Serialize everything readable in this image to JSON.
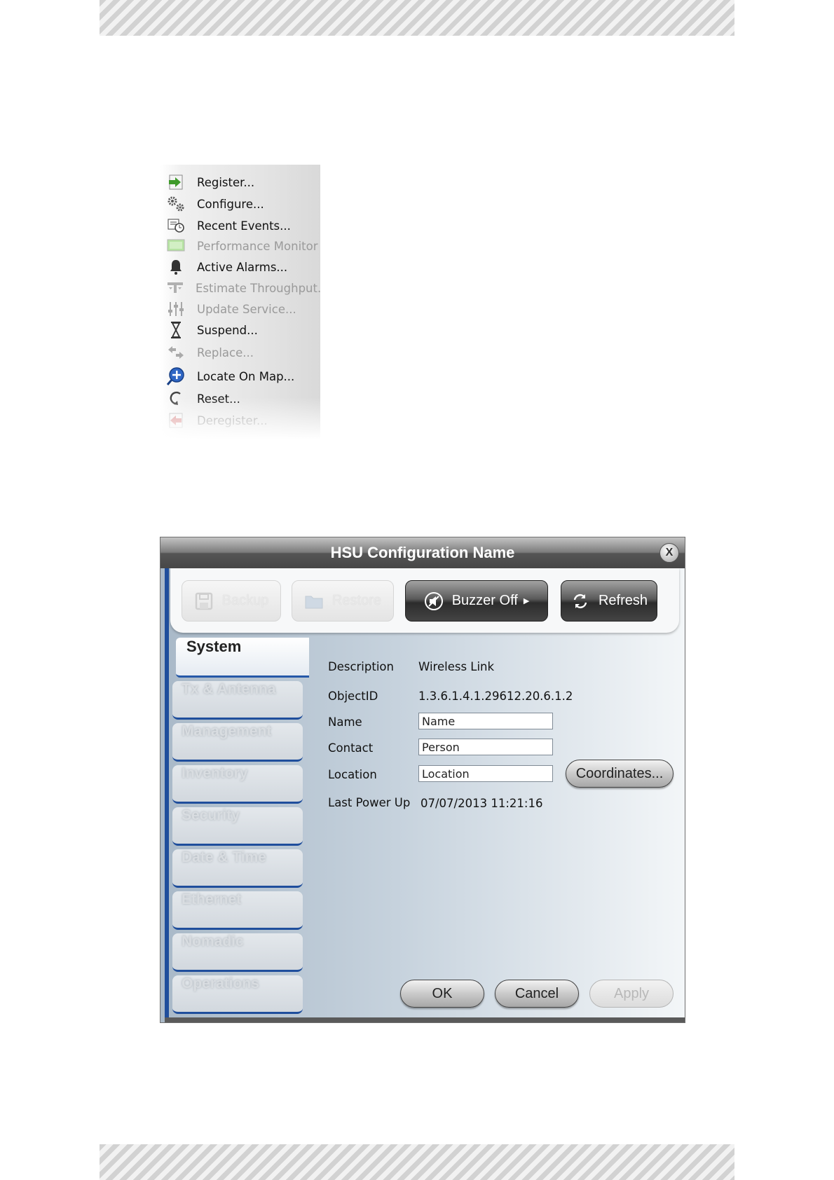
{
  "context_menu": {
    "items": [
      {
        "label": "Register...",
        "enabled": true,
        "icon": "register-icon"
      },
      {
        "label": "Configure...",
        "enabled": true,
        "icon": "gears-icon"
      },
      {
        "label": "Recent Events...",
        "enabled": true,
        "icon": "events-icon"
      },
      {
        "label": "Performance Monitor",
        "enabled": false,
        "icon": "monitor-icon"
      },
      {
        "label": "Active Alarms...",
        "enabled": true,
        "icon": "bell-icon"
      },
      {
        "label": "Estimate Throughput...",
        "enabled": false,
        "icon": "throughput-icon"
      },
      {
        "label": "Update Service...",
        "enabled": false,
        "icon": "sliders-icon"
      },
      {
        "label": "Suspend...",
        "enabled": true,
        "icon": "hourglass-icon"
      },
      {
        "label": "Replace...",
        "enabled": false,
        "icon": "replace-icon"
      },
      {
        "label": "Locate On Map...",
        "enabled": true,
        "icon": "locate-icon"
      },
      {
        "label": "Reset...",
        "enabled": true,
        "icon": "reset-icon"
      },
      {
        "label": "Deregister...",
        "enabled": false,
        "icon": "deregister-icon"
      }
    ]
  },
  "dialog": {
    "title": "HSU Configuration Name",
    "close_label": "X",
    "toolbar": {
      "backup": "Backup",
      "restore": "Restore",
      "buzzer_off": "Buzzer Off",
      "refresh": "Refresh"
    },
    "nav": {
      "active": "System",
      "items": [
        "Tx & Antenna",
        "Management",
        "Inventory",
        "Security",
        "Date & Time",
        "Ethernet",
        "Nomadic",
        "Operations"
      ]
    },
    "form": {
      "description_label": "Description",
      "description_value": "Wireless Link",
      "objectid_label": "ObjectID",
      "objectid_value": "1.3.6.1.4.1.29612.20.6.1.2",
      "name_label": "Name",
      "name_value": "Name",
      "contact_label": "Contact",
      "contact_value": "Person",
      "location_label": "Location",
      "location_value": "Location",
      "coordinates_button": "Coordinates...",
      "last_power_up_label": "Last Power Up",
      "last_power_up_value": "07/07/2013 11:21:16"
    },
    "buttons": {
      "ok": "OK",
      "cancel": "Cancel",
      "apply": "Apply"
    },
    "colors": {
      "nav_accent": "#1f4e9c",
      "titlebar": "#555555"
    }
  }
}
